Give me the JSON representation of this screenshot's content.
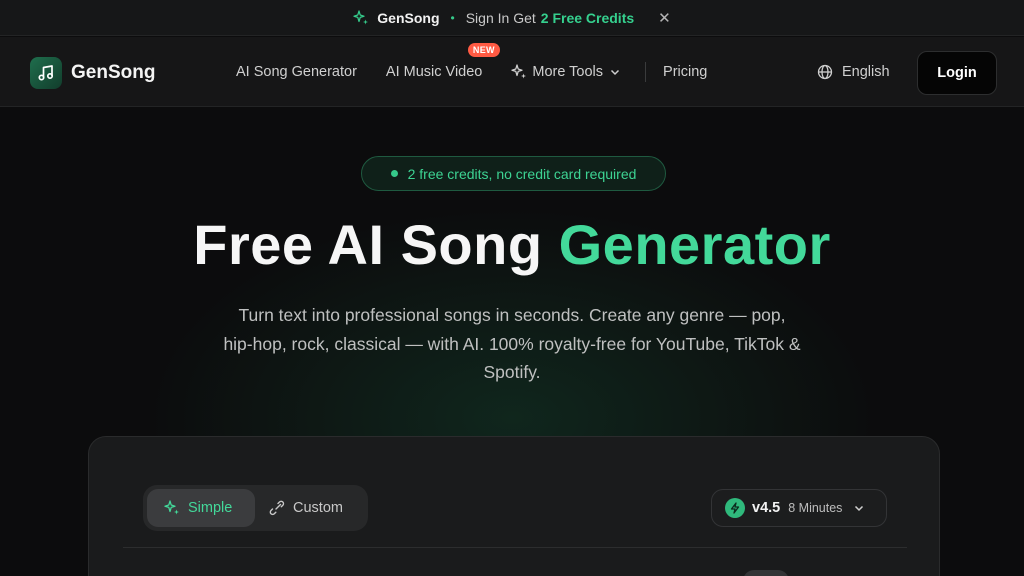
{
  "announce": {
    "brand": "GenSong",
    "separator": "•",
    "message": "Sign In Get",
    "highlight": "2 Free Credits",
    "close": "✕"
  },
  "nav": {
    "logo_text": "GenSong",
    "links": [
      "AI Song Generator",
      "AI Music Video",
      "More Tools",
      "Pricing"
    ],
    "new_badge": "NEW",
    "language": "English",
    "login": "Login"
  },
  "hero": {
    "pill": "2 free credits, no credit card required",
    "title_main": "Free AI Song",
    "title_accent": "Generator",
    "subtitle": "Turn text into professional songs in seconds. Create any genre — pop, hip-hop, rock, classical — with AI. 100% royalty-free for YouTube, TikTok & Spotify."
  },
  "generator": {
    "modes": [
      "Simple",
      "Custom"
    ],
    "active_mode": "Simple",
    "model": "v4.5",
    "duration": "8 Minutes"
  },
  "colors": {
    "accent": "#43d99a",
    "badge": "#ff5a43",
    "background": "#0c0c0d"
  },
  "icons": [
    "sparkle-icon",
    "close-icon",
    "music-note-icon",
    "chevron-down-icon",
    "globe-icon",
    "link-icon",
    "lightning-icon"
  ]
}
